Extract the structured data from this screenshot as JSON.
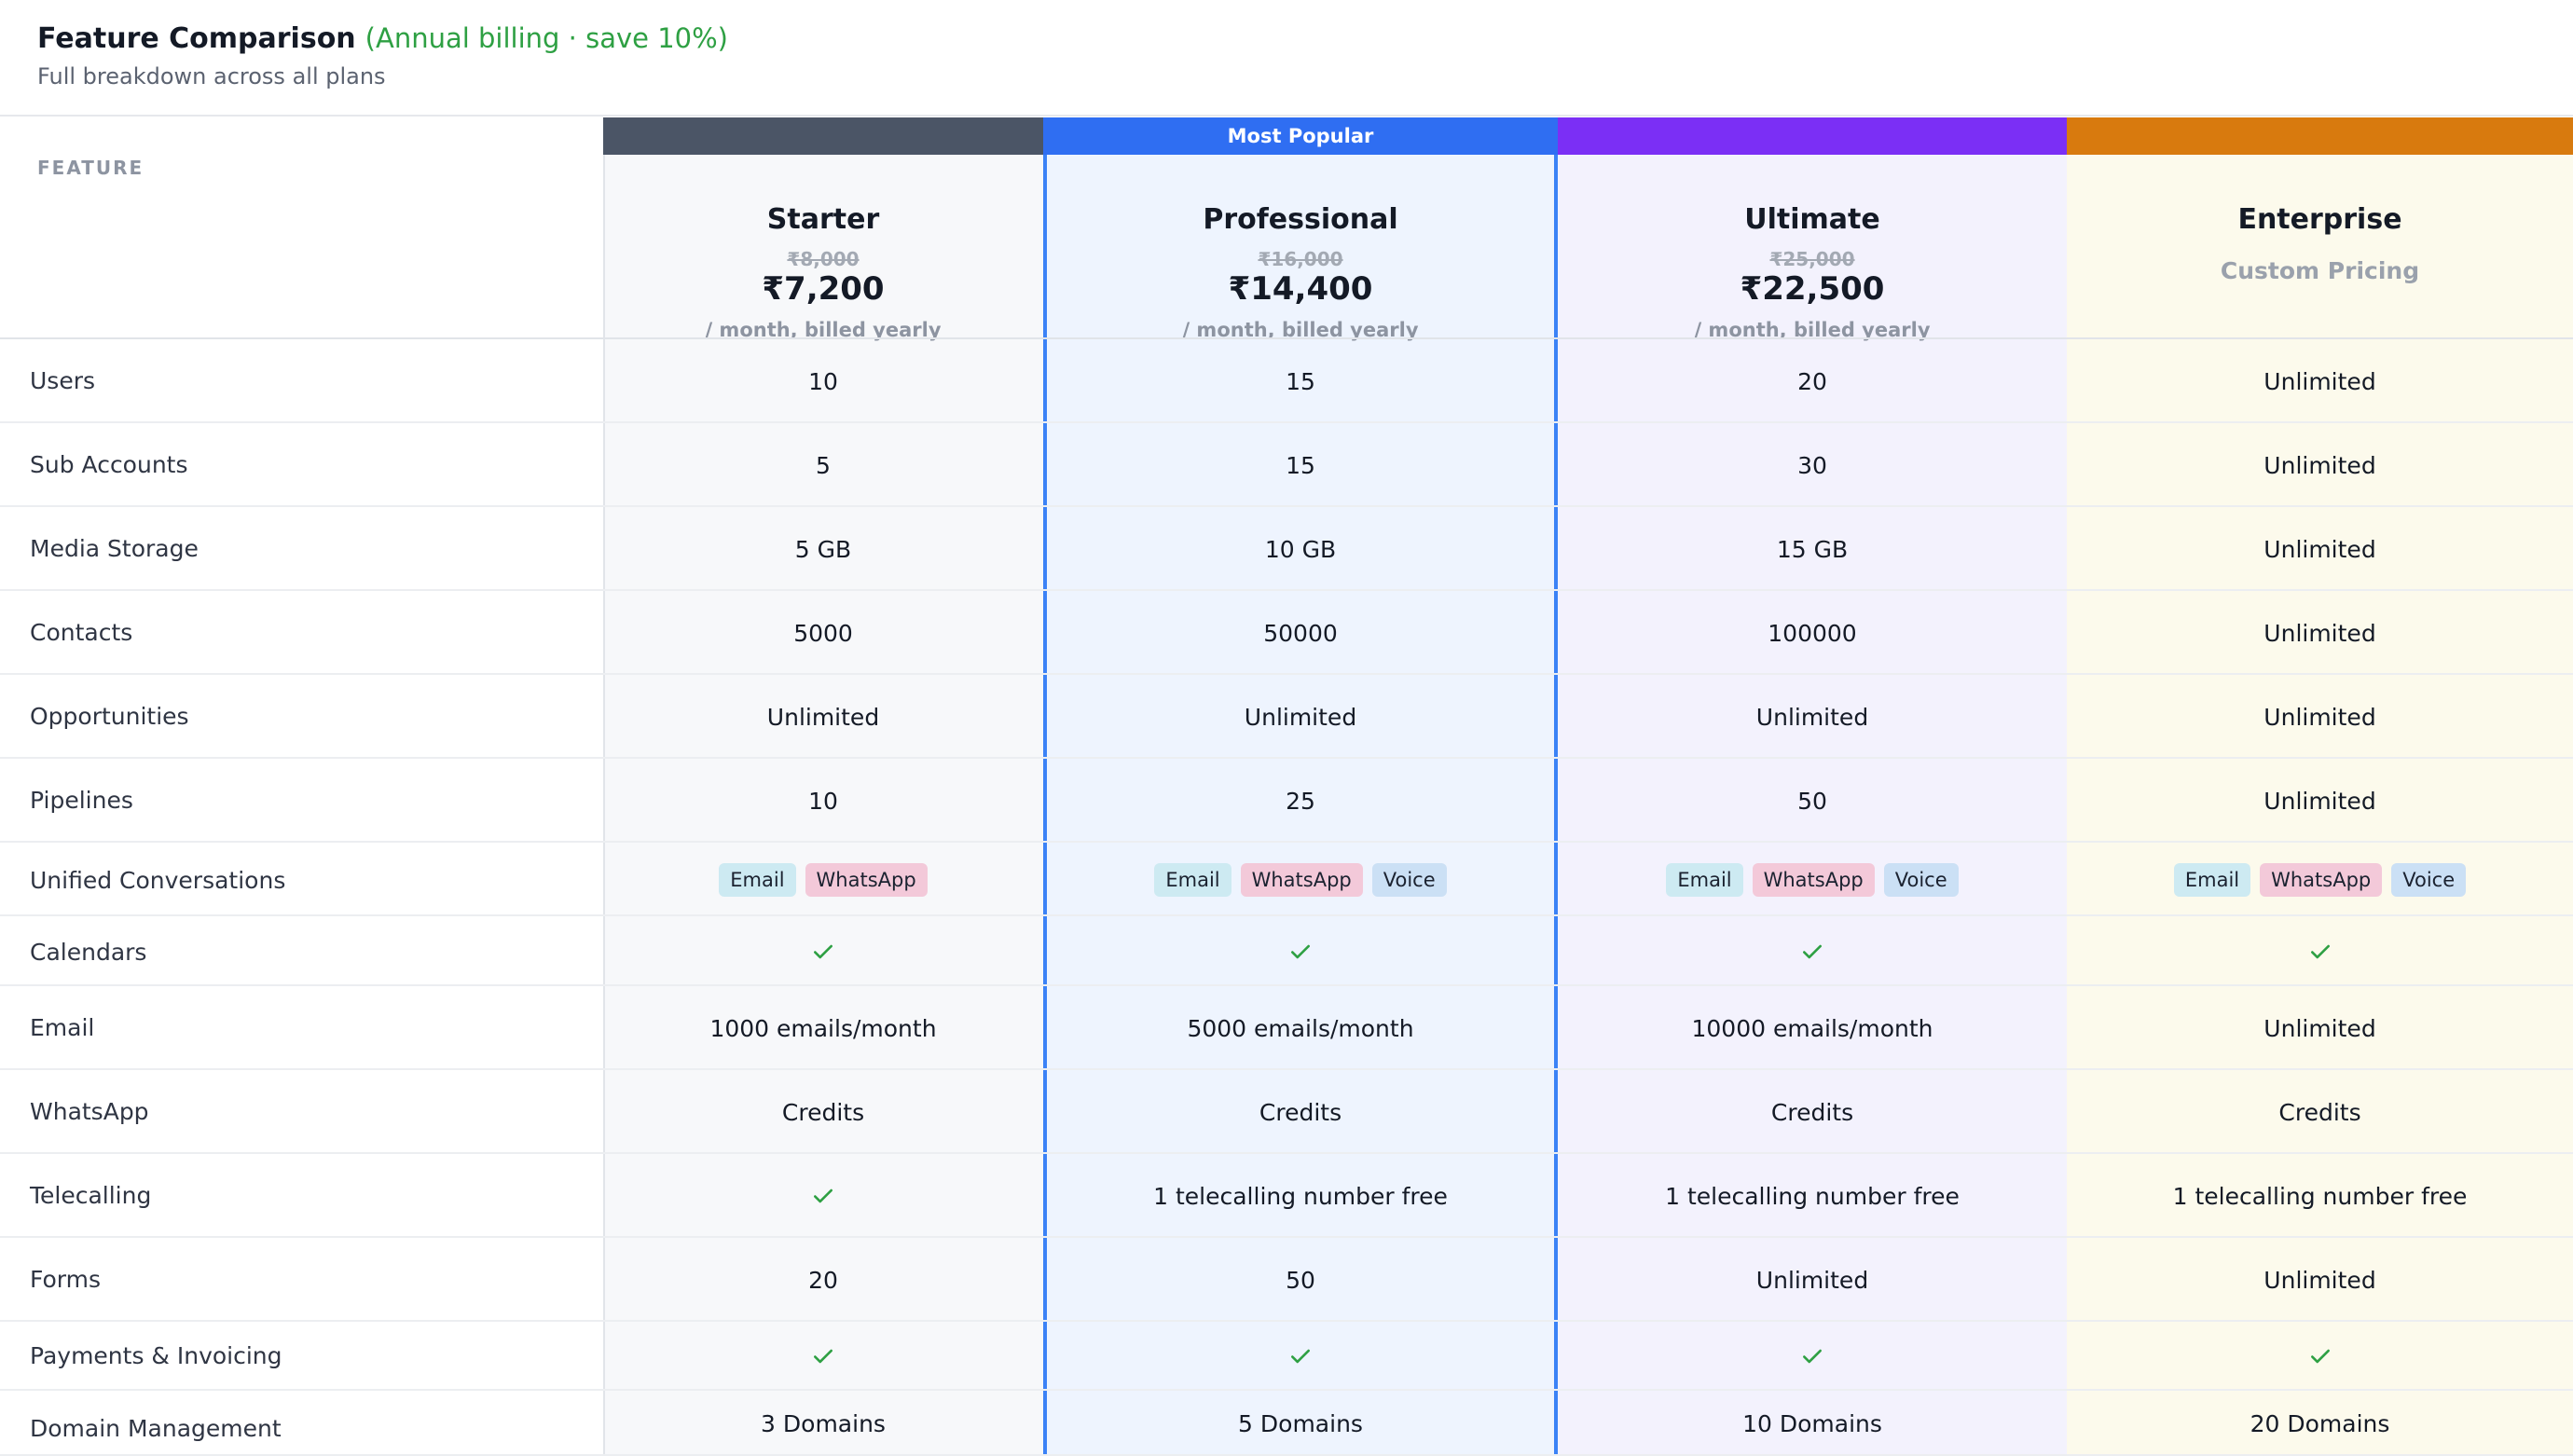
{
  "header": {
    "title": "Feature Comparison",
    "title_note": "(Annual billing · save 10%)",
    "subtitle": "Full breakdown across all plans"
  },
  "table": {
    "feature_header": "FEATURE",
    "popular_label": "Most Popular",
    "bar_colors": [
      "#4b5566",
      "#2f6ef2",
      "#7b2ff5",
      "#d87a0e"
    ],
    "plans": [
      {
        "name": "Starter",
        "old_price": "₹8,000",
        "price": "₹7,200",
        "period": "/ month, billed yearly"
      },
      {
        "name": "Professional",
        "old_price": "₹16,000",
        "price": "₹14,400",
        "period": "/ month, billed yearly"
      },
      {
        "name": "Ultimate",
        "old_price": "₹25,000",
        "price": "₹22,500",
        "period": "/ month, billed yearly"
      },
      {
        "name": "Enterprise",
        "custom": "Custom Pricing"
      }
    ],
    "channel_labels": {
      "email": "Email",
      "whatsapp": "WhatsApp",
      "voice": "Voice"
    },
    "check_icon": "check-icon",
    "check_color": "#2ea043",
    "rows": [
      {
        "feature": "Users",
        "values": [
          "10",
          "15",
          "20",
          "Unlimited"
        ]
      },
      {
        "feature": "Sub Accounts",
        "values": [
          "5",
          "15",
          "30",
          "Unlimited"
        ]
      },
      {
        "feature": "Media Storage",
        "values": [
          "5 GB",
          "10 GB",
          "15 GB",
          "Unlimited"
        ]
      },
      {
        "feature": "Contacts",
        "values": [
          "5000",
          "50000",
          "100000",
          "Unlimited"
        ]
      },
      {
        "feature": "Opportunities",
        "values": [
          "Unlimited",
          "Unlimited",
          "Unlimited",
          "Unlimited"
        ]
      },
      {
        "feature": "Pipelines",
        "values": [
          "10",
          "25",
          "50",
          "Unlimited"
        ]
      },
      {
        "feature": "Unified Conversations",
        "channels": [
          [
            "Email",
            "WhatsApp"
          ],
          [
            "Email",
            "WhatsApp",
            "Voice"
          ],
          [
            "Email",
            "WhatsApp",
            "Voice"
          ],
          [
            "Email",
            "WhatsApp",
            "Voice"
          ]
        ]
      },
      {
        "feature": "Calendars",
        "included": [
          true,
          true,
          true,
          true
        ]
      },
      {
        "feature": "Email",
        "values": [
          "1000 emails/month",
          "5000 emails/month",
          "10000 emails/month",
          "Unlimited"
        ]
      },
      {
        "feature": "WhatsApp",
        "values": [
          "Credits",
          "Credits",
          "Credits",
          "Credits"
        ]
      },
      {
        "feature": "Telecalling",
        "values": [
          "",
          "1 telecalling number free",
          "1 telecalling number free",
          "1 telecalling number free"
        ],
        "included": [
          true,
          false,
          false,
          false
        ]
      },
      {
        "feature": "Forms",
        "values": [
          "20",
          "50",
          "Unlimited",
          "Unlimited"
        ]
      },
      {
        "feature": "Payments & Invoicing",
        "included": [
          true,
          true,
          true,
          true
        ]
      },
      {
        "feature": "Domain Management",
        "values": [
          "3 Domains",
          "5 Domains",
          "10 Domains",
          "20 Domains"
        ]
      }
    ]
  }
}
